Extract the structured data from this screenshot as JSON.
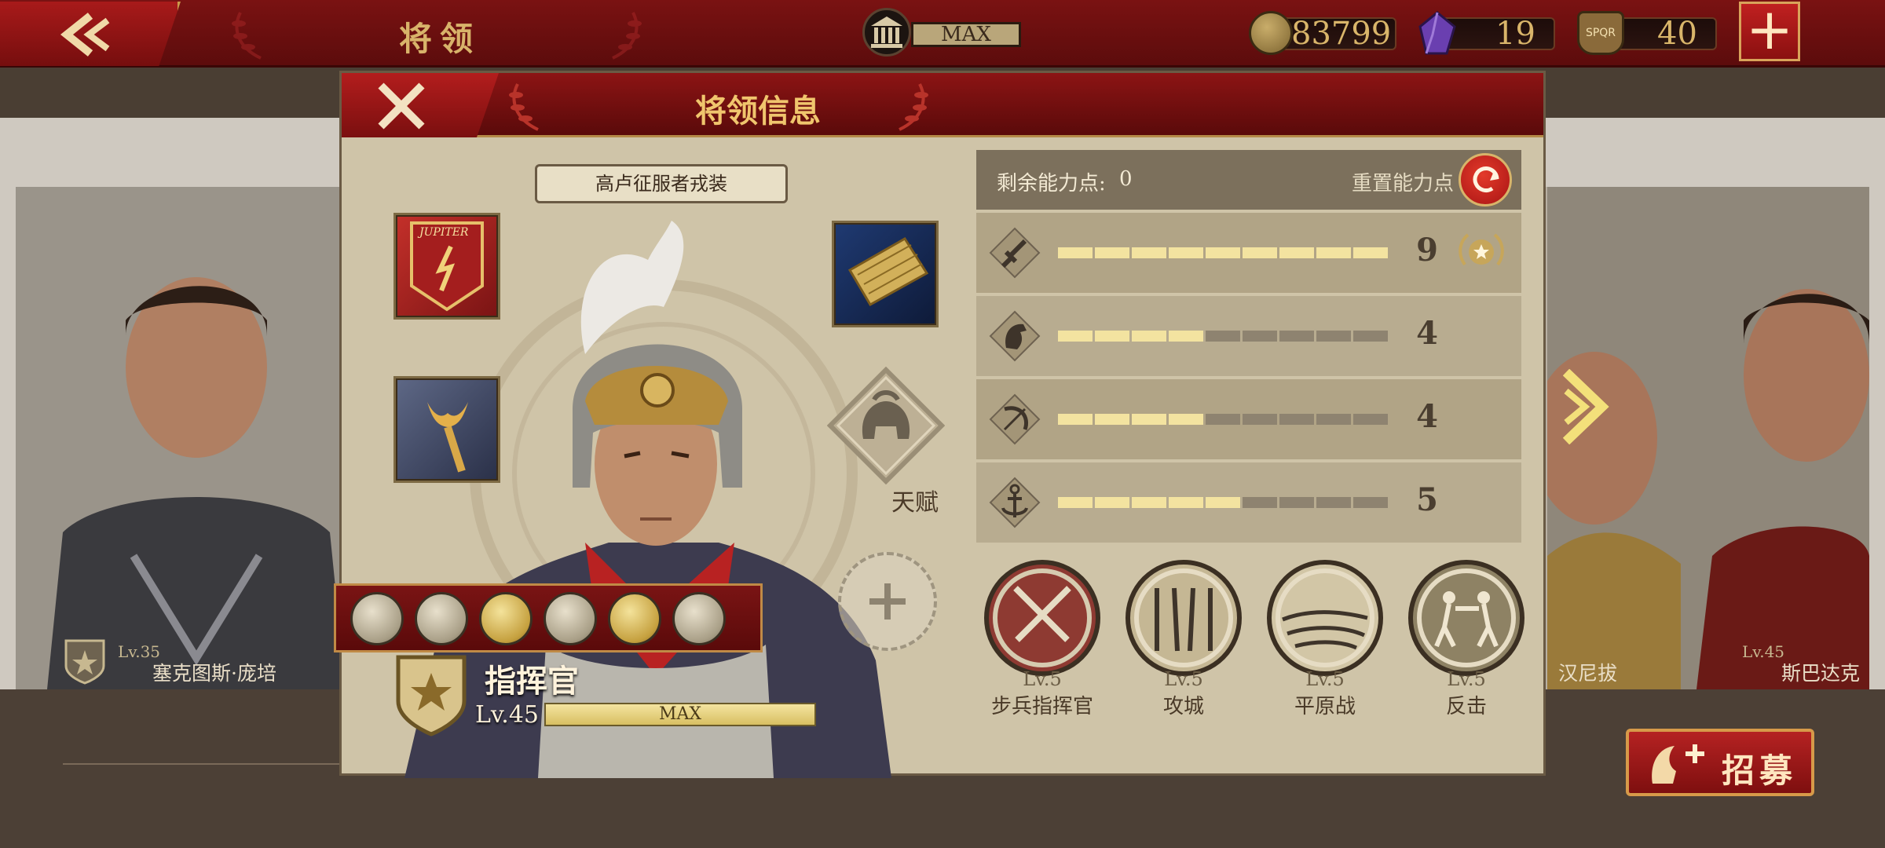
{
  "topbar": {
    "title": "将领",
    "capacity_label": "MAX",
    "coins": "83799",
    "gems": "19",
    "tokens": "40",
    "token_badge": "SPQR"
  },
  "background": {
    "left_general": {
      "level": "Lv.35",
      "name": "塞克图斯·庞培"
    },
    "right_general_1": {
      "name": "汉尼拔"
    },
    "right_general_2": {
      "level": "Lv.45",
      "name": "斯巴达克"
    },
    "recruit_label": "招募"
  },
  "modal": {
    "title": "将领信息",
    "outfit": "高卢征服者戎装",
    "banner_text": "JUPITER",
    "talent_label": "天赋",
    "rank_title": "指挥官",
    "level": "Lv.45",
    "level_bar": "MAX",
    "level_progress_percent": 100,
    "points": {
      "label": "剩余能力点:",
      "value": "0",
      "reset_label": "重置能力点"
    },
    "attributes": [
      {
        "icon": "sword-icon",
        "value": "9",
        "filled": 9,
        "max": 9
      },
      {
        "icon": "horse-icon",
        "value": "4",
        "filled": 4,
        "max": 9
      },
      {
        "icon": "bow-icon",
        "value": "4",
        "filled": 4,
        "max": 9
      },
      {
        "icon": "anchor-icon",
        "value": "5",
        "filled": 5,
        "max": 9
      }
    ],
    "specialties": [
      {
        "level": "Lv.5",
        "name": "步兵指挥官"
      },
      {
        "level": "Lv.5",
        "name": "攻城"
      },
      {
        "level": "Lv.5",
        "name": "平原战"
      },
      {
        "level": "Lv.5",
        "name": "反击"
      }
    ]
  },
  "colors": {
    "header_red": "#7a1212",
    "gold_text": "#f0c56d",
    "parchment": "#cfc4a8",
    "bar_on": "#f3e3a0",
    "bar_off": "#8e8370"
  }
}
